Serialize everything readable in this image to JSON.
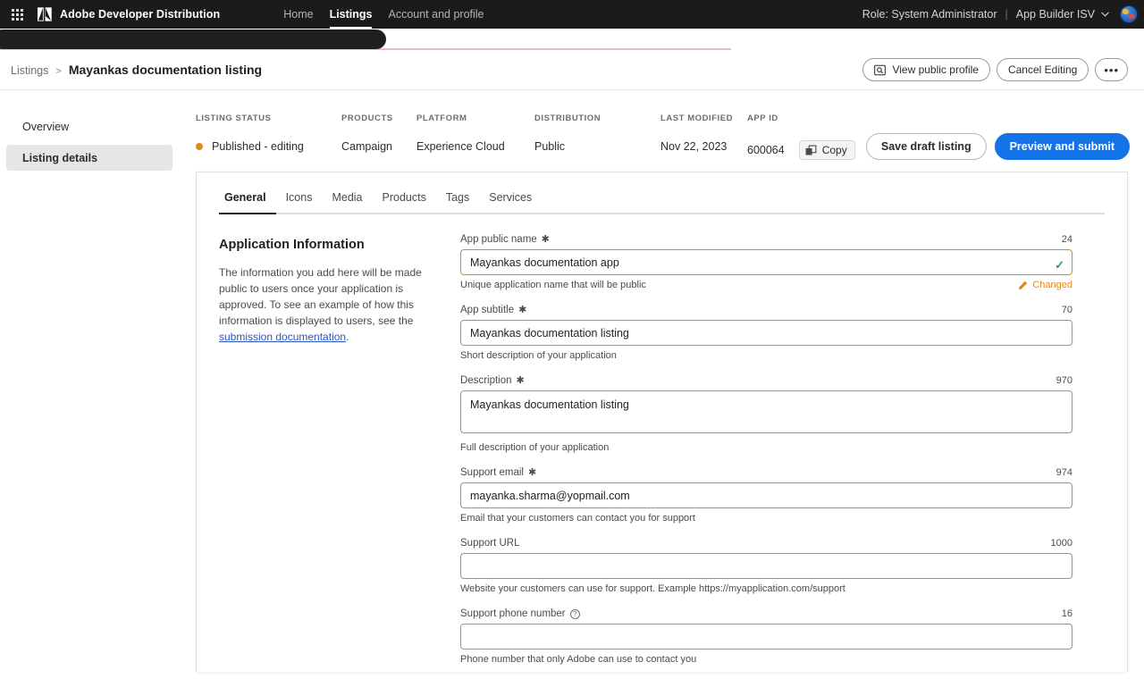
{
  "topnav": {
    "app_grid_icon": "app-grid-icon",
    "brand": "Adobe Developer Distribution",
    "links": [
      {
        "label": "Home",
        "active": false
      },
      {
        "label": "Listings",
        "active": true
      },
      {
        "label": "Account and profile",
        "active": false
      }
    ],
    "role": "Role: System Administrator",
    "separator": "|",
    "org": "App Builder ISV",
    "chevron_icon": "chevron-down-icon",
    "avatar_icon": "user-avatar"
  },
  "breadcrumb": {
    "parent": "Listings",
    "separator": ">",
    "current": "Mayankas documentation listing",
    "view_public_profile": "View public profile",
    "view_icon": "preview-search-icon",
    "cancel_editing": "Cancel Editing",
    "more_label": "•••"
  },
  "status": {
    "columns": [
      {
        "label": "LISTING STATUS",
        "value": "Published - editing"
      },
      {
        "label": "PRODUCTS",
        "value": "Campaign"
      },
      {
        "label": "PLATFORM",
        "value": "Experience Cloud"
      },
      {
        "label": "DISTRIBUTION",
        "value": "Public"
      },
      {
        "label": "LAST MODIFIED",
        "value": "Nov 22, 2023"
      },
      {
        "label": "APP ID",
        "value": "600064"
      }
    ],
    "status_dot_color": "#e68619",
    "copy_label": "Copy",
    "copy_icon": "copy-icon",
    "save_draft": "Save draft listing",
    "preview_submit": "Preview and submit",
    "accent_color": "#1473e6"
  },
  "sidebar": {
    "items": [
      {
        "label": "Overview",
        "active": false
      },
      {
        "label": "Listing details",
        "active": true
      }
    ]
  },
  "tabs": [
    {
      "label": "General",
      "active": true
    },
    {
      "label": "Icons",
      "active": false
    },
    {
      "label": "Media",
      "active": false
    },
    {
      "label": "Products",
      "active": false
    },
    {
      "label": "Tags",
      "active": false
    },
    {
      "label": "Services",
      "active": false
    }
  ],
  "info": {
    "title": "Application Information",
    "body": "The information you add here will be made public to users once your application is approved. To see an example of how this information is displayed to users, see the ",
    "link": "submission documentation",
    "body_end": "."
  },
  "form": {
    "app_public_name": {
      "label": "App public name",
      "required": "✱",
      "counter": "24",
      "value": "Mayankas documentation app",
      "placeholder": "",
      "help": "Unique application name that will be public",
      "changed_label": "Changed",
      "changed_icon": "pencil-icon",
      "valid_icon": "checkmark-icon",
      "changed_color": "#e68619",
      "valid_color": "#2d9d5f"
    },
    "app_subtitle": {
      "label": "App subtitle",
      "required": "✱",
      "counter": "70",
      "value": "Mayankas documentation listing",
      "placeholder": "",
      "help": "Short description of your application"
    },
    "description": {
      "label": "Description",
      "required": "✱",
      "counter": "970",
      "value": "Mayankas documentation listing",
      "placeholder": "",
      "help": "Full description of your application"
    },
    "support_email": {
      "label": "Support email",
      "required": "✱",
      "counter": "974",
      "value": "mayanka.sharma@yopmail.com",
      "placeholder": "",
      "help": "Email that your customers can contact you for support"
    },
    "support_url": {
      "label": "Support URL",
      "required": "",
      "counter": "1000",
      "value": "",
      "placeholder": "",
      "help": "Website your customers can use for support. Example https://myapplication.com/support"
    },
    "support_phone": {
      "label": "Support phone number",
      "required": "",
      "info_icon": "help-circle-icon",
      "counter": "16",
      "value": "",
      "placeholder": "",
      "help": "Phone number that only Adobe can use to contact you"
    }
  }
}
